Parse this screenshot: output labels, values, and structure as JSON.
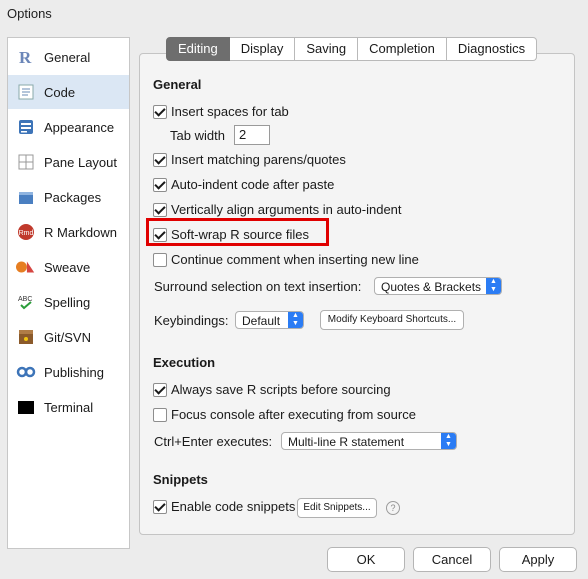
{
  "window": {
    "title": "Options"
  },
  "sidebar": {
    "items": [
      {
        "label": "General",
        "icon": "r-logo-icon",
        "selected": false
      },
      {
        "label": "Code",
        "icon": "code-icon",
        "selected": true
      },
      {
        "label": "Appearance",
        "icon": "appearance-icon",
        "selected": false
      },
      {
        "label": "Pane Layout",
        "icon": "pane-layout-icon",
        "selected": false
      },
      {
        "label": "Packages",
        "icon": "packages-icon",
        "selected": false
      },
      {
        "label": "R Markdown",
        "icon": "rmd-icon",
        "selected": false
      },
      {
        "label": "Sweave",
        "icon": "sweave-icon",
        "selected": false
      },
      {
        "label": "Spelling",
        "icon": "spelling-icon",
        "selected": false
      },
      {
        "label": "Git/SVN",
        "icon": "git-svn-icon",
        "selected": false
      },
      {
        "label": "Publishing",
        "icon": "publishing-icon",
        "selected": false
      },
      {
        "label": "Terminal",
        "icon": "terminal-icon",
        "selected": false
      }
    ]
  },
  "tabs": [
    {
      "label": "Editing",
      "active": true
    },
    {
      "label": "Display",
      "active": false
    },
    {
      "label": "Saving",
      "active": false
    },
    {
      "label": "Completion",
      "active": false
    },
    {
      "label": "Diagnostics",
      "active": false
    }
  ],
  "general": {
    "title": "General",
    "insert_spaces": {
      "label": "Insert spaces for tab",
      "checked": true
    },
    "tab_width": {
      "label": "Tab width",
      "value": "2"
    },
    "matching_parens": {
      "label": "Insert matching parens/quotes",
      "checked": true
    },
    "auto_indent": {
      "label": "Auto-indent code after paste",
      "checked": true
    },
    "vertical_align": {
      "label": "Vertically align arguments in auto-indent",
      "checked": true
    },
    "soft_wrap": {
      "label": "Soft-wrap R source files",
      "checked": true
    },
    "continue_comment": {
      "label": "Continue comment when inserting new line",
      "checked": false
    },
    "surround": {
      "label": "Surround selection on text insertion:",
      "value": "Quotes & Brackets"
    },
    "keybindings": {
      "label": "Keybindings:",
      "value": "Default",
      "modify_label": "Modify Keyboard Shortcuts..."
    }
  },
  "execution": {
    "title": "Execution",
    "always_save": {
      "label": "Always save R scripts before sourcing",
      "checked": true
    },
    "focus_console": {
      "label": "Focus console after executing from source",
      "checked": false
    },
    "ctrl_enter": {
      "label": "Ctrl+Enter executes:",
      "value": "Multi-line R statement"
    }
  },
  "snippets": {
    "title": "Snippets",
    "enable": {
      "label": "Enable code snippets",
      "checked": true
    },
    "edit_label": "Edit Snippets...",
    "help": "?"
  },
  "footer": {
    "ok": "OK",
    "cancel": "Cancel",
    "apply": "Apply"
  },
  "colors": {
    "accent": "#2b7cf4",
    "highlight": "#e00000",
    "selected_row": "#dbe7f4"
  }
}
